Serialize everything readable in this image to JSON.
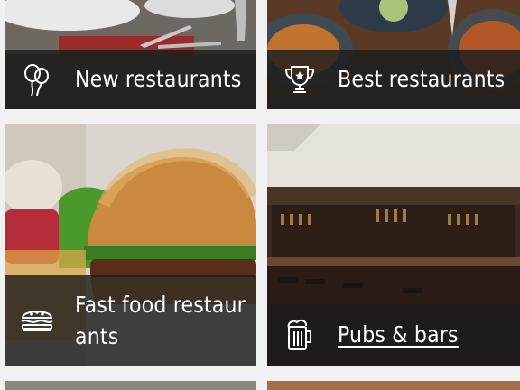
{
  "categories": [
    {
      "id": "new",
      "label": "New restaurants",
      "icon": "balloons-icon",
      "link": false
    },
    {
      "id": "best",
      "label": "Best restaurants",
      "icon": "trophy-icon",
      "link": false
    },
    {
      "id": "fast-food",
      "label": "Fast food restaur ants",
      "icon": "burger-icon",
      "link": false
    },
    {
      "id": "pubs",
      "label": "Pubs & bars",
      "icon": "beer-mug-icon",
      "link": true
    }
  ],
  "colors": {
    "background": "#f1f1f1",
    "overlay": "#1c1c1c",
    "text": "#ffffff"
  }
}
